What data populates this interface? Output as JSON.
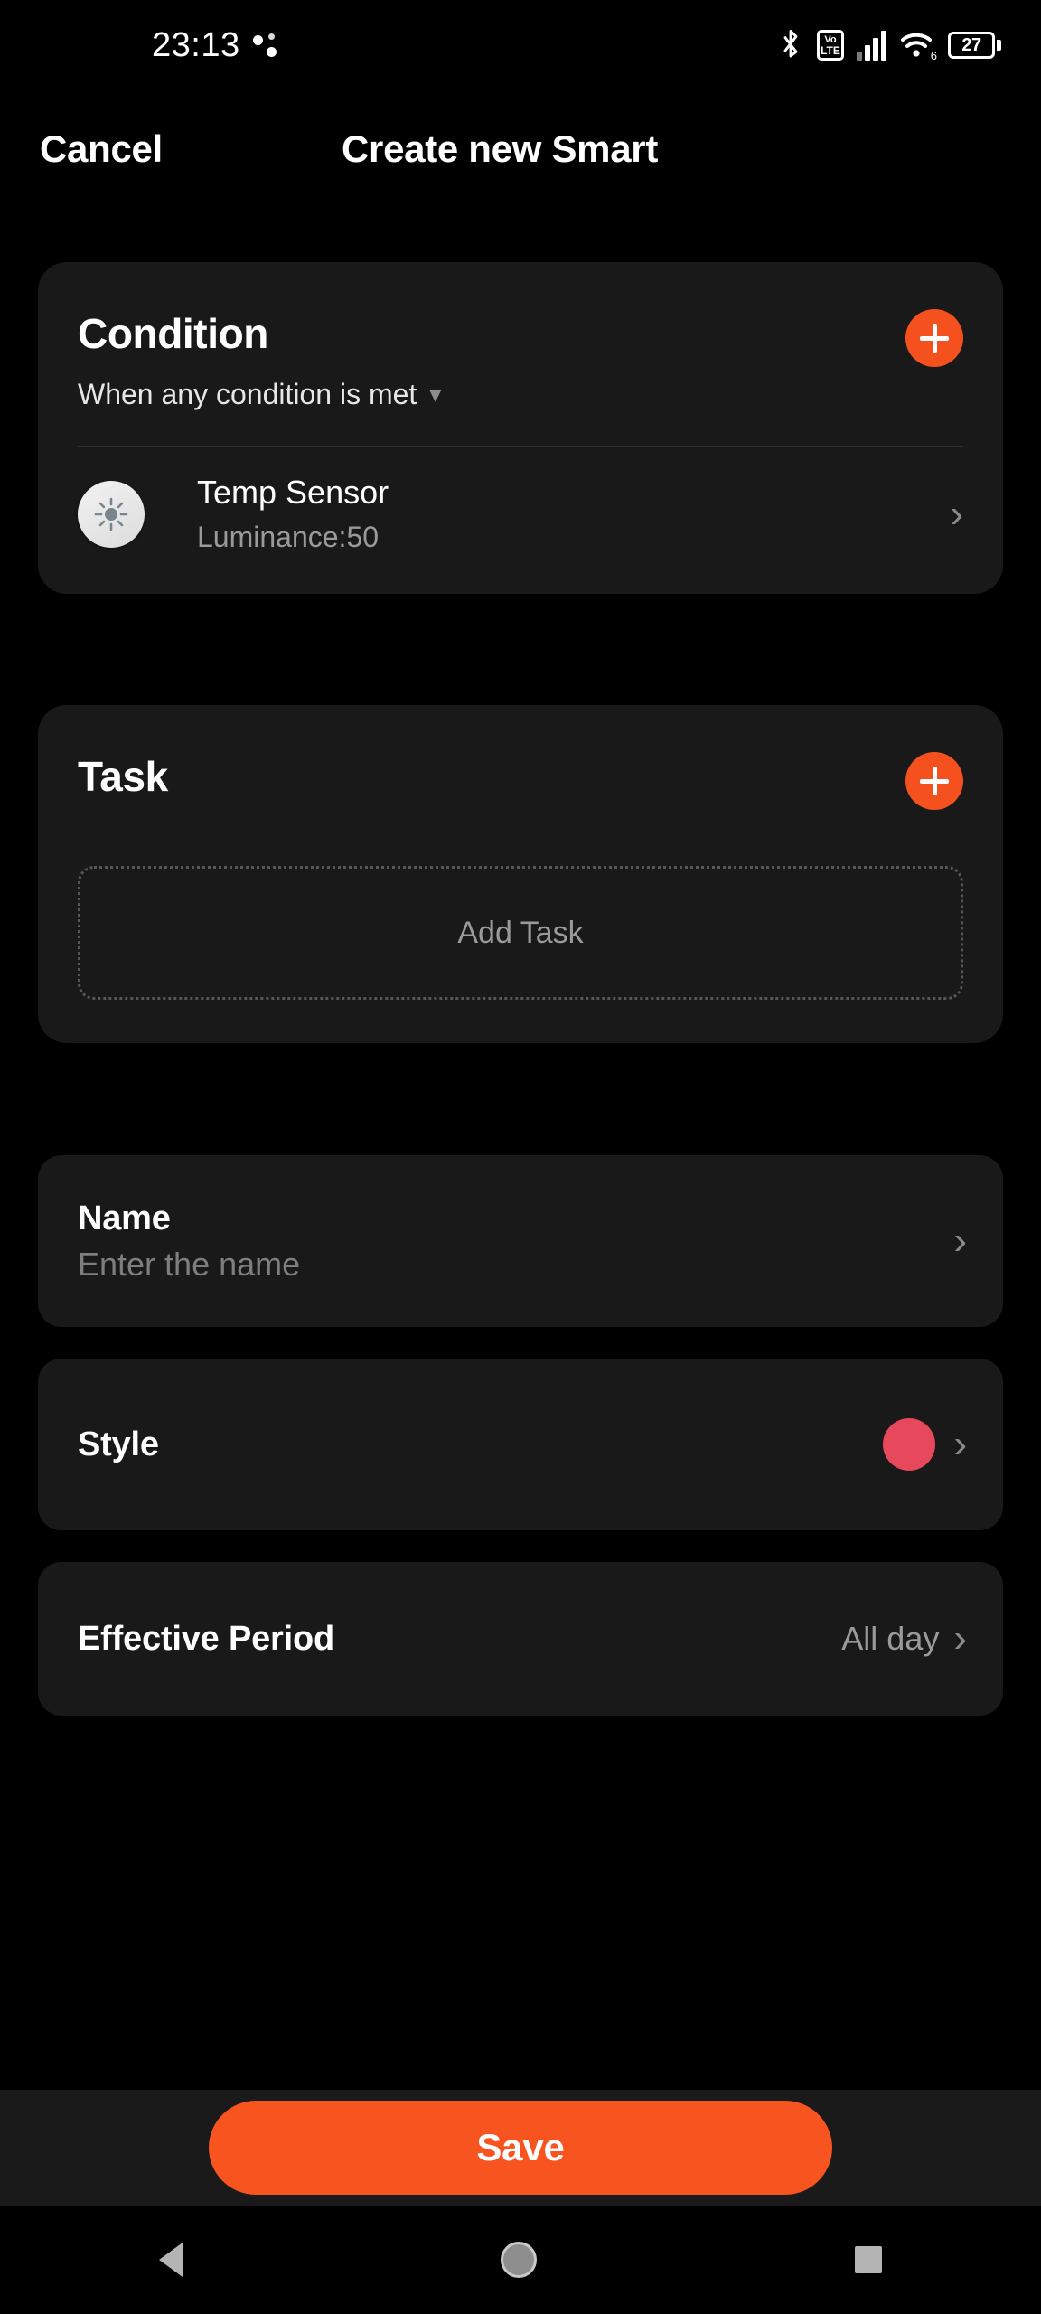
{
  "status_bar": {
    "clock": "23:13",
    "icons": [
      "dots-indicator-icon",
      "bluetooth-icon",
      "volte-icon",
      "cellular-signal-icon",
      "wifi-6-icon",
      "battery-icon"
    ],
    "volte_top": "Vo",
    "volte_bottom": "LTE",
    "wifi_generation": "6",
    "battery_level": "27"
  },
  "header": {
    "cancel_label": "Cancel",
    "title": "Create new Smart"
  },
  "condition_card": {
    "title": "Condition",
    "subtitle": "When any condition is met",
    "add_icon": "plus-icon",
    "devices": [
      {
        "icon": "brightness-sensor-icon",
        "name": "Temp Sensor",
        "state": "Luminance:50",
        "chevron": "chevron-right-icon"
      }
    ]
  },
  "task_card": {
    "title": "Task",
    "add_icon": "plus-icon",
    "placeholder_label": "Add Task"
  },
  "settings": {
    "name_row": {
      "label": "Name",
      "placeholder": "Enter the name",
      "chevron": "chevron-right-icon"
    },
    "style_row": {
      "label": "Style",
      "swatch_color": "#e8485c",
      "chevron": "chevron-right-icon"
    },
    "effective_period_row": {
      "label": "Effective Period",
      "value": "All day",
      "chevron": "chevron-right-icon"
    }
  },
  "footer": {
    "save_label": "Save"
  },
  "nav_bar": {
    "back": "back-triangle-icon",
    "home": "home-circle-icon",
    "recents": "recents-square-icon"
  },
  "colors": {
    "accent": "#f4511e",
    "save_button": "#f7541f",
    "card_bg": "#191919",
    "page_bg": "#000000",
    "style_swatch": "#e8485c"
  }
}
